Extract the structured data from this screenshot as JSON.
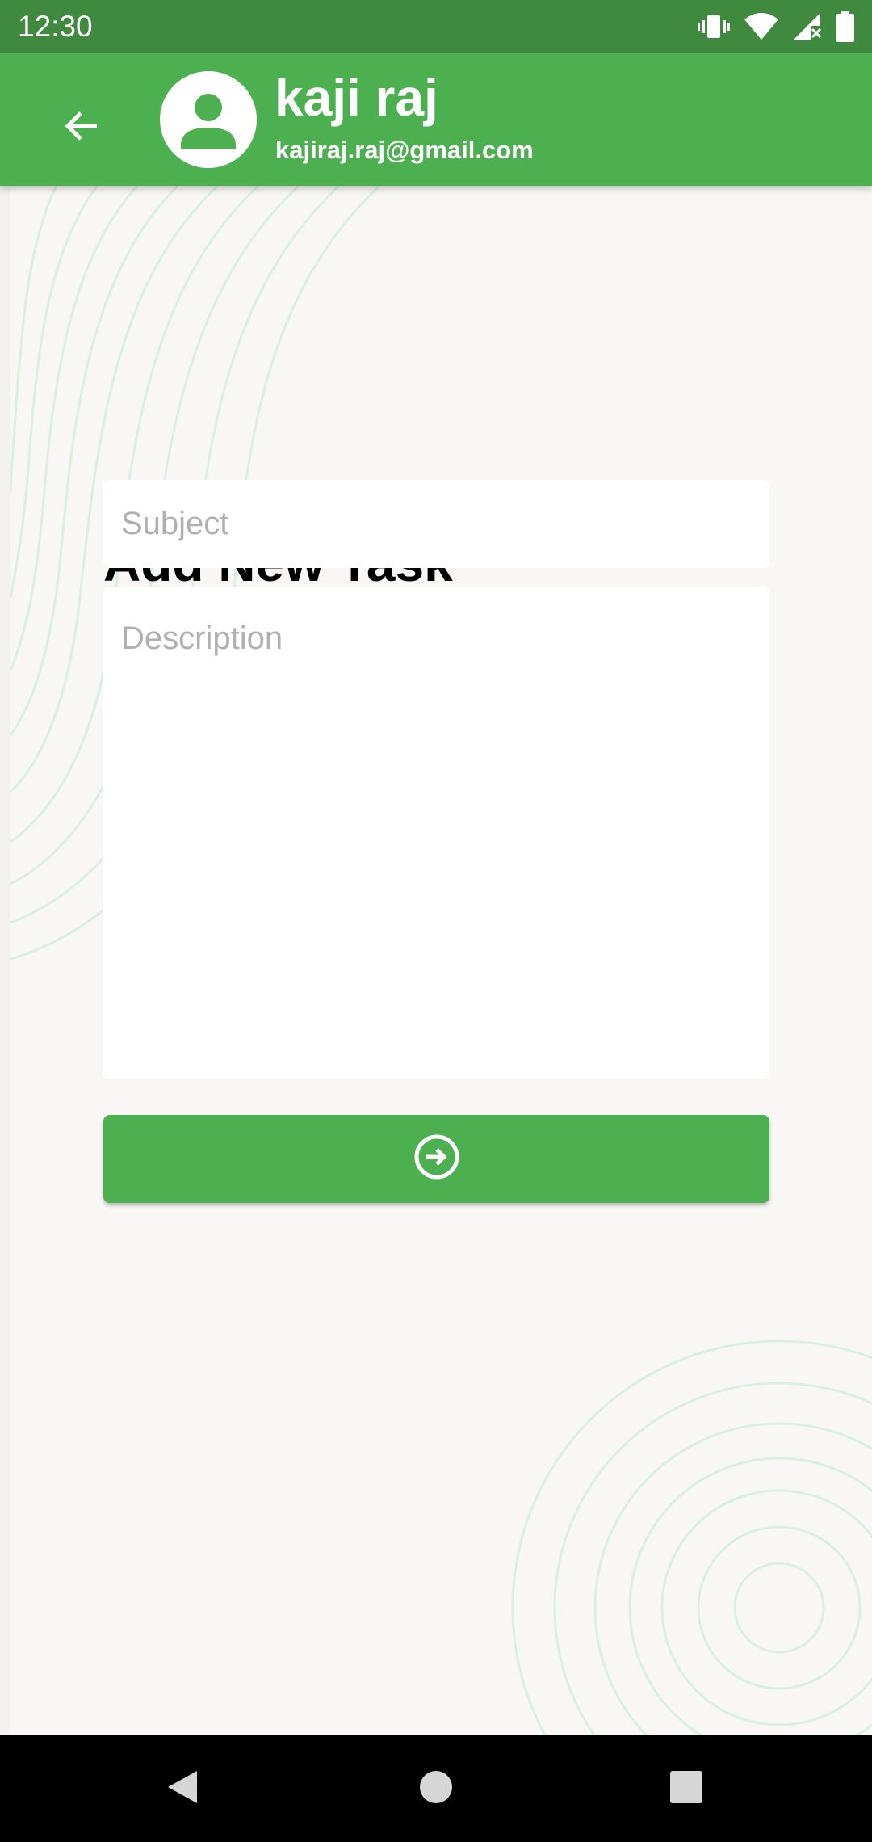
{
  "status_bar": {
    "time": "12:30",
    "icons": [
      "vibrate-icon",
      "wifi-icon",
      "signal-icon",
      "battery-icon"
    ]
  },
  "app_bar": {
    "back_icon": "arrow-back-icon",
    "avatar_icon": "person-icon",
    "user_name": "kaji raj",
    "user_email": "kajiraj.raj@gmail.com"
  },
  "form": {
    "title": "Add New Task",
    "subject_placeholder": "Subject",
    "subject_value": "",
    "description_placeholder": "Description",
    "description_value": "",
    "submit_icon": "arrow-circle-right-icon"
  },
  "nav_bar": {
    "icons": [
      "back-triangle-icon",
      "home-circle-icon",
      "recents-square-icon"
    ]
  },
  "colors": {
    "primary": "#4caf50",
    "status_bar": "#3f8a3f",
    "background": "#f8f7f5",
    "decoration": "#dbeee2",
    "placeholder": "#b0b0b0"
  }
}
